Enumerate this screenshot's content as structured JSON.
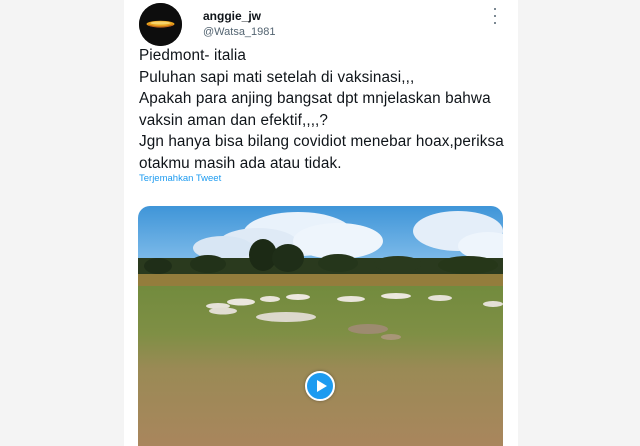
{
  "user": {
    "display_name": "anggie_jw",
    "handle": "@Watsa_1981",
    "avatar_icon": "avatar-image"
  },
  "tweet": {
    "lines": [
      "Piedmont- italia",
      "Puluhan sapi mati setelah di vaksinasi,,,",
      "Apakah para anjing  bangsat dpt mnjelaskan bahwa",
      "vaksin aman dan efektif,,,,?",
      "Jgn hanya bisa bilang covidiot menebar hoax,periksa",
      "otakmu masih ada atau tidak."
    ],
    "translate_label": "Terjemahkan Tweet"
  },
  "media": {
    "type": "video",
    "play_icon": "play-icon"
  },
  "colors": {
    "accent": "#1d9bf0",
    "text": "#0f1419",
    "secondary": "#536471",
    "background": "#f4f4f4"
  }
}
